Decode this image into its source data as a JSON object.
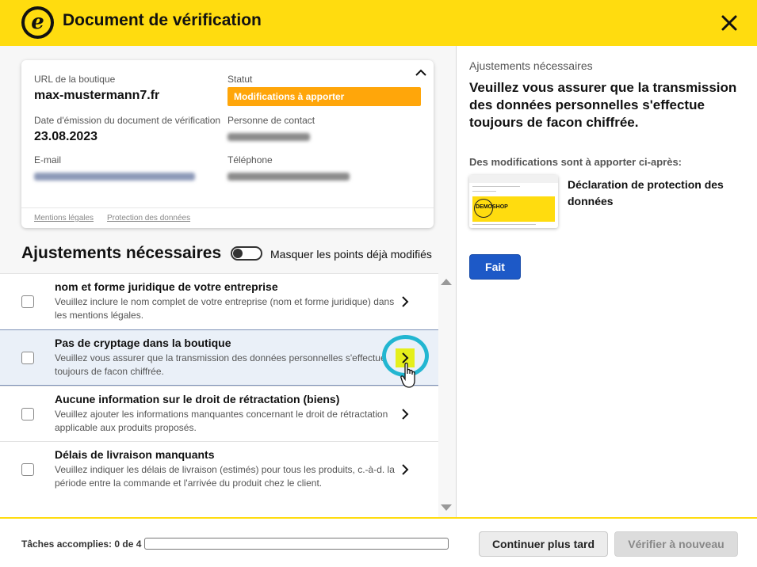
{
  "header": {
    "logo_letter": "e",
    "title": "Document de vérification",
    "close_icon": "close-icon"
  },
  "card": {
    "shop_url_label": "URL de la boutique",
    "shop_url": "max-mustermann7.fr",
    "status_label": "Statut",
    "status": "Modifications à apporter",
    "issue_date_label": "Date d'émission du document de vérification",
    "issue_date": "23.08.2023",
    "contact_label": "Personne de contact",
    "email_label": "E-mail",
    "phone_label": "Téléphone",
    "footer_links": [
      "Mentions légales",
      "Protection des données"
    ],
    "colors": {
      "status_badge": "#ffa60a"
    }
  },
  "adjustments": {
    "title": "Ajustements nécessaires",
    "toggle_label": "Masquer les points déjà modifiés",
    "toggle_on": false,
    "items": [
      {
        "title": "nom et forme juridique de votre entreprise",
        "description": "Veuillez inclure le nom complet de votre entreprise (nom et forme juridique) dans les mentions légales.",
        "checked": false,
        "selected": false
      },
      {
        "title": "Pas de cryptage dans la boutique",
        "description": "Veuillez vous assurer que la transmission des données personnelles s'effectue toujours de facon chiffrée.",
        "checked": false,
        "selected": true
      },
      {
        "title": "Aucune information sur le droit de rétractation (biens)",
        "description": "Veuillez ajouter les informations manquantes concernant le droit de rétractation applicable aux produits proposés.",
        "checked": false,
        "selected": false
      },
      {
        "title": "Délais de livraison manquants",
        "description": "Veuillez indiquer les délais de livraison (estimés) pour tous les produits, c.-à-d. la période entre la commande et l'arrivée du produit chez le client.",
        "checked": false,
        "selected": false
      }
    ]
  },
  "detail": {
    "eyebrow": "Ajustements nécessaires",
    "title": "Veuillez vous assurer que la transmission des données personnelles s'effectue toujours de facon chiffrée.",
    "subtitle": "Des modifications sont à apporter ci-après:",
    "document": "Déclaration de protection des données",
    "thumbnail_logo": "DEMOSHOP",
    "done_button": "Fait"
  },
  "footer": {
    "tasks_label": "Tâches accomplies: 0 de 4",
    "progress_fraction": 0,
    "later_button": "Continuer plus tard",
    "verify_button": "Vérifier à nouveau",
    "verify_enabled": false
  },
  "colors": {
    "brand_yellow": "#ffdc0f",
    "primary_blue": "#1d59c7",
    "highlight_ring": "#22b6d1",
    "chevron_highlight": "#e5ef1b"
  }
}
